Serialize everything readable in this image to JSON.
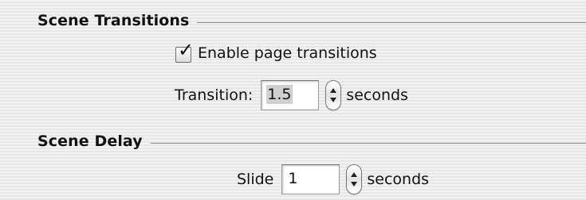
{
  "scene_transitions": {
    "title": "Scene Transitions",
    "enable_checkbox": {
      "label": "Enable page transitions",
      "checked": true
    },
    "transition_label": "Transition:",
    "transition_value": "1.5",
    "transition_unit": "seconds"
  },
  "scene_delay": {
    "title": "Scene Delay",
    "slide_label": "Slide",
    "slide_value": "1",
    "slide_unit": "seconds"
  },
  "icons": {
    "checkmark": "checkmark-icon",
    "stepper_up": "arrow-up-icon",
    "stepper_down": "arrow-down-icon"
  }
}
